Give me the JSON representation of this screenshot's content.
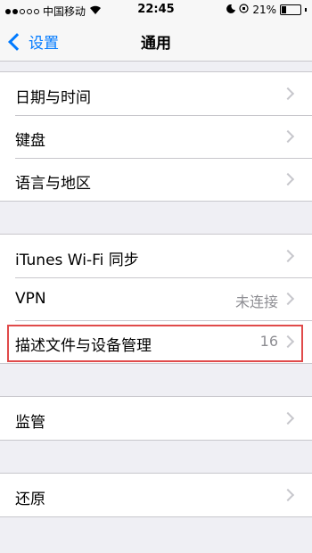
{
  "status_bar": {
    "carrier": "中国移动",
    "time": "22:45",
    "battery_percent": "21%",
    "battery_level": 0.21
  },
  "nav": {
    "back_label": "设置",
    "title": "通用"
  },
  "groups": [
    {
      "items": [
        {
          "label": "日期与时间"
        },
        {
          "label": "键盘"
        },
        {
          "label": "语言与地区"
        }
      ]
    },
    {
      "items": [
        {
          "label": "iTunes Wi-Fi 同步"
        },
        {
          "label": "VPN",
          "detail": "未连接"
        },
        {
          "label": "描述文件与设备管理",
          "detail": "16"
        }
      ]
    },
    {
      "items": [
        {
          "label": "监管"
        }
      ]
    },
    {
      "items": [
        {
          "label": "还原"
        }
      ]
    }
  ],
  "colors": {
    "accent": "#007aff",
    "highlight": "#e04a4a",
    "background": "#efeff4"
  }
}
